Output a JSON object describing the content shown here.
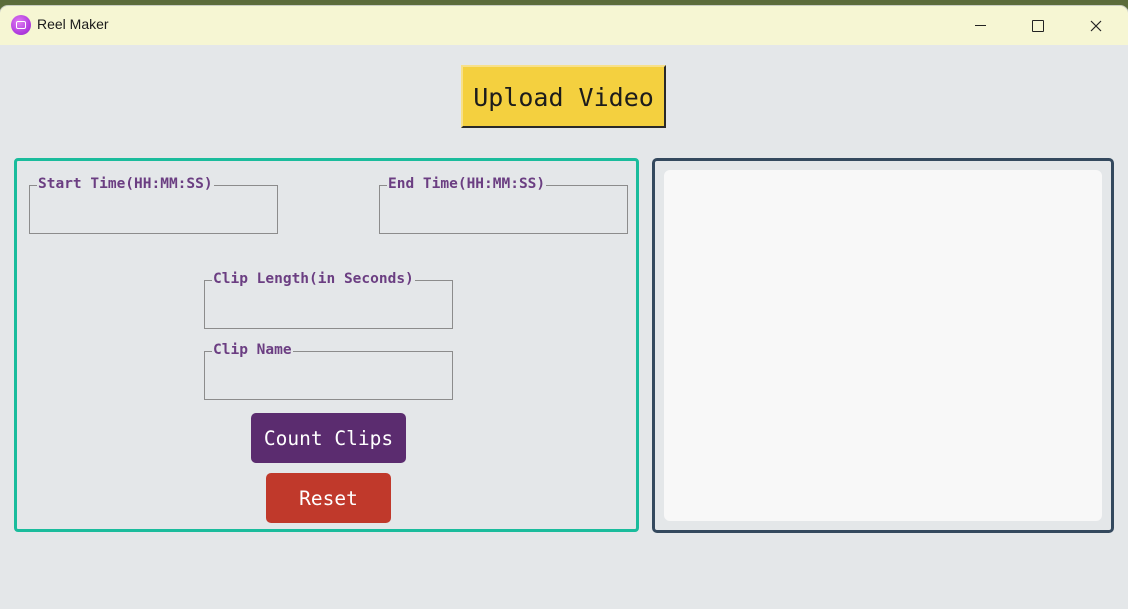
{
  "window": {
    "title": "Reel Maker",
    "controls": {
      "minimize": "minimize-icon",
      "maximize": "maximize-icon",
      "close": "close-icon"
    }
  },
  "upload": {
    "label": "Upload Video",
    "color": "#f4d03f"
  },
  "form": {
    "border_color": "#1abc9c",
    "start_time": {
      "label": "Start Time(HH:MM:SS)",
      "value": ""
    },
    "end_time": {
      "label": "End Time(HH:MM:SS)",
      "value": ""
    },
    "clip_length": {
      "label": "Clip Length(in Seconds)",
      "value": ""
    },
    "clip_name": {
      "label": "Clip Name",
      "value": ""
    },
    "label_color": "#6b3e82"
  },
  "actions": {
    "count_clips": {
      "label": "Count Clips",
      "color": "#5b2c6f"
    },
    "reset": {
      "label": "Reset",
      "color": "#c0392b"
    }
  },
  "preview": {
    "border_color": "#34495e",
    "background": "#f8f8f8"
  }
}
